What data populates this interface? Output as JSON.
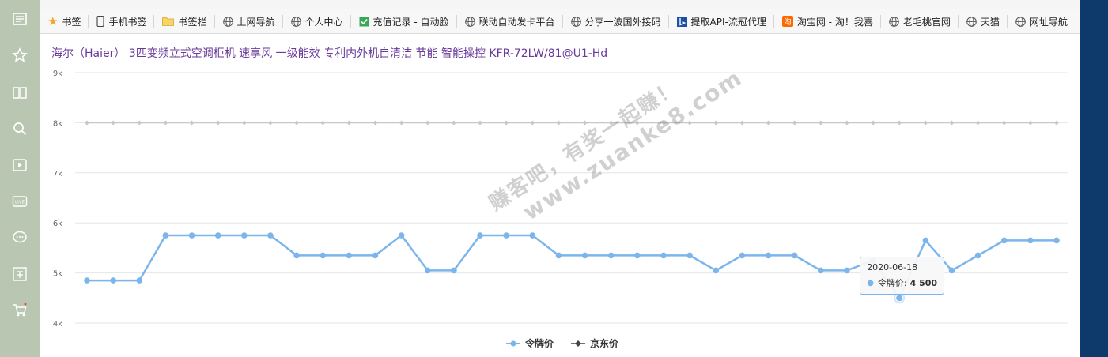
{
  "bookmarks": [
    {
      "label": "书签",
      "icon": "star-icon"
    },
    {
      "label": "手机书签",
      "icon": "phone-icon"
    },
    {
      "label": "书签栏",
      "icon": "folder-icon"
    },
    {
      "label": "上网导航",
      "icon": "globe-icon"
    },
    {
      "label": "个人中心",
      "icon": "globe-icon"
    },
    {
      "label": "充值记录 - 自动脸",
      "icon": "check-icon"
    },
    {
      "label": "联动自动发卡平台",
      "icon": "globe-icon"
    },
    {
      "label": "分享一波国外接码",
      "icon": "globe-icon"
    },
    {
      "label": "提取API-流冠代理",
      "icon": "bing-icon"
    },
    {
      "label": "淘宝网 - 淘！我喜",
      "icon": "taobao-icon"
    },
    {
      "label": "老毛桃官网",
      "icon": "globe-icon"
    },
    {
      "label": "天猫",
      "icon": "globe-icon"
    },
    {
      "label": "网址导航",
      "icon": "globe-icon"
    }
  ],
  "bookmarks_more": "»",
  "product_title": "海尔（Haier） 3匹变频立式空调柜机 速享风 一级能效 专利内外机自清洁 节能 智能操控 KFR-72LW/81@U1-Hd",
  "watermark": {
    "line1": "赚客吧，有奖一起赚！",
    "line2": "www.zuanke8.com"
  },
  "tooltip": {
    "date": "2020-06-18",
    "series": "令牌价",
    "value": "4 500",
    "index": 31
  },
  "colors": {
    "lingpai": "#7cb5ec",
    "jd": "#c8c8c8",
    "sidebar": "#b9c6b1"
  },
  "chart_data": {
    "type": "line",
    "ylim": [
      4000,
      9000
    ],
    "y_ticks": [
      4000,
      5000,
      6000,
      7000,
      8000,
      9000
    ],
    "y_tick_labels": [
      "4k",
      "5k",
      "6k",
      "7k",
      "8k",
      "9k"
    ],
    "grid": true,
    "legend_position": "bottom-center",
    "series": [
      {
        "name": "令牌价",
        "color": "#7cb5ec",
        "values": [
          4850,
          4850,
          4850,
          5750,
          5750,
          5750,
          5750,
          5750,
          5350,
          5350,
          5350,
          5350,
          5750,
          5050,
          5050,
          5750,
          5750,
          5750,
          5350,
          5350,
          5350,
          5350,
          5350,
          5350,
          5050,
          5350,
          5350,
          5350,
          5050,
          5050,
          5250,
          4500,
          5650,
          5050,
          5350,
          5650,
          5650,
          5650
        ]
      },
      {
        "name": "京东价",
        "color": "#c8c8c8",
        "values": [
          7999,
          7999,
          7999,
          7999,
          7999,
          7999,
          7999,
          7999,
          7999,
          7999,
          7999,
          7999,
          7999,
          7999,
          7999,
          7999,
          7999,
          7999,
          7999,
          7999,
          7999,
          7999,
          7999,
          7999,
          7999,
          7999,
          7999,
          7999,
          7999,
          7999,
          7999,
          7999,
          7999,
          7999,
          7999,
          7999,
          7999,
          7999
        ]
      }
    ]
  }
}
